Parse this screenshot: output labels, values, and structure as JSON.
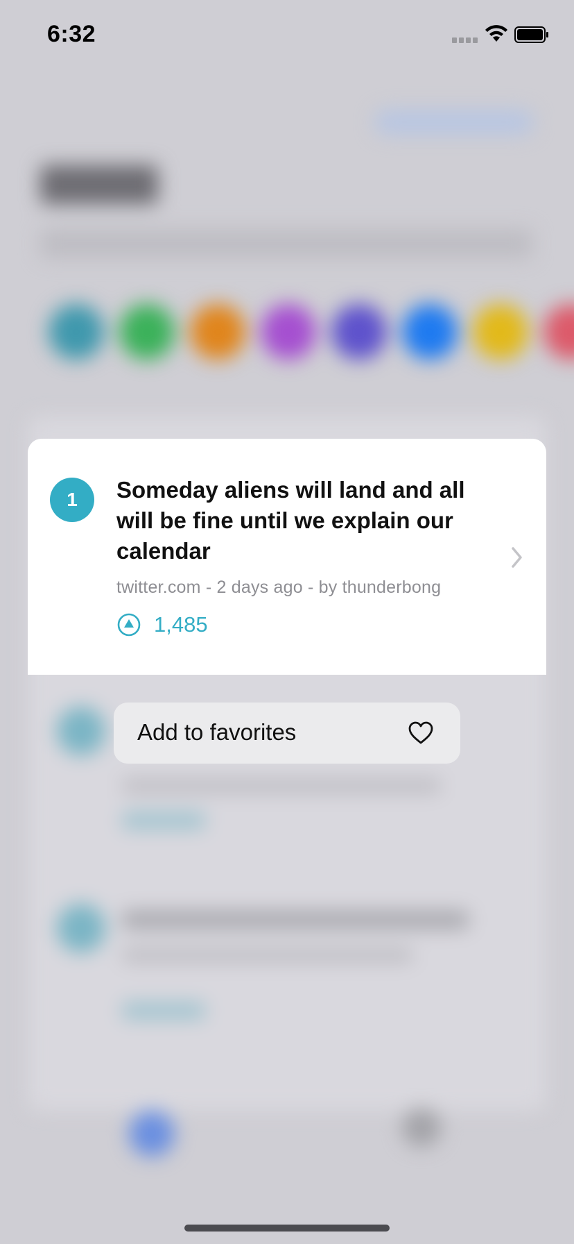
{
  "status_bar": {
    "time": "6:32"
  },
  "background_circle_colors": [
    "#3f98ad",
    "#3bb15a",
    "#e0851c",
    "#a54fd0",
    "#5e52cc",
    "#1e7af0",
    "#e2b91a",
    "#dc5a6a"
  ],
  "preview": {
    "rank": "1",
    "title": "Someday aliens will land and all will be fine until we explain our calendar",
    "meta": "twitter.com - 2 days ago - by thunderbong",
    "score": "1,485"
  },
  "context_menu": {
    "add_favorites_label": "Add to favorites"
  },
  "colors": {
    "accent": "#33adc5",
    "menu_bg": "#ebebed"
  }
}
